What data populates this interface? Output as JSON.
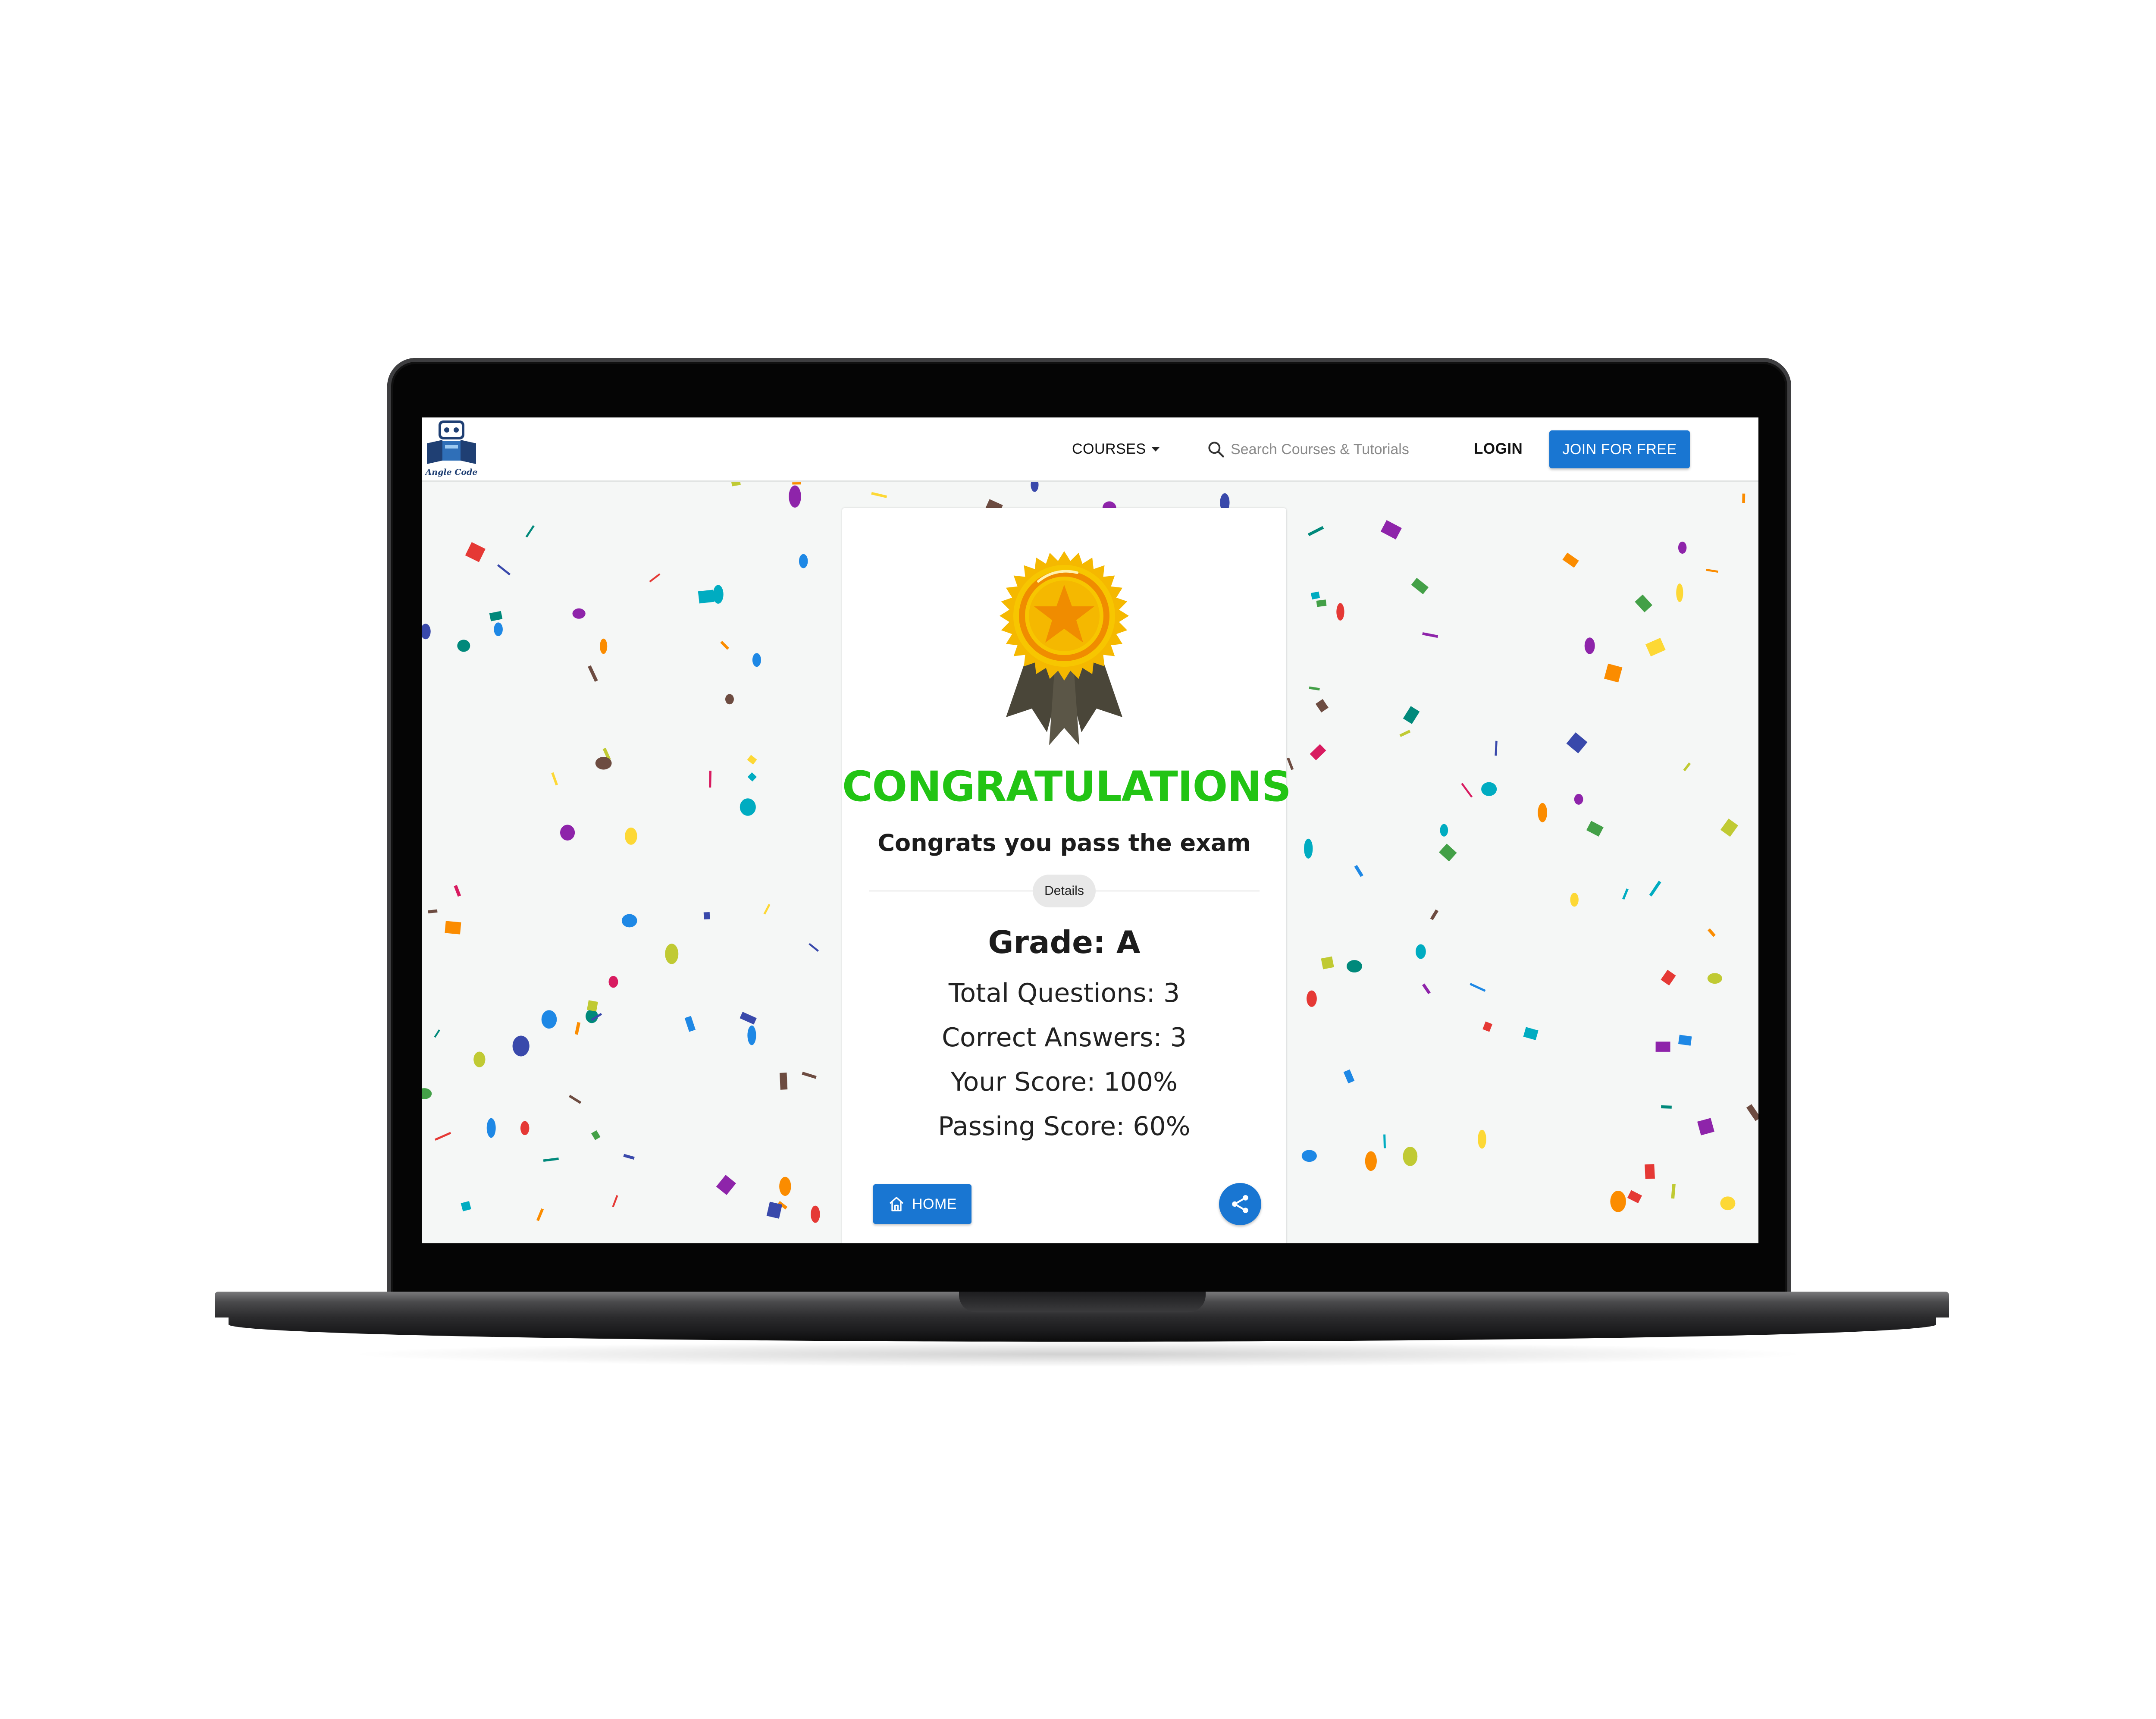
{
  "navbar": {
    "logo_text": "Angle Code",
    "courses_label": "COURSES",
    "search_placeholder": "Search Courses & Tutorials",
    "login_label": "LOGIN",
    "join_label": "JOIN FOR FREE"
  },
  "result": {
    "title": "CONGRATULATIONS",
    "subtitle": "Congrats you pass the exam",
    "details_label": "Details",
    "grade": "Grade: A",
    "total_questions": "Total Questions: 3",
    "correct_answers": "Correct Answers: 3",
    "your_score": "Your Score: 100%",
    "passing_score": "Passing Score: 60%",
    "home_label": "HOME"
  },
  "icons": [
    "robot-logo-icon",
    "chevron-down-icon",
    "search-icon",
    "medal-icon",
    "home-icon",
    "share-icon"
  ],
  "colors": {
    "primary": "#1976d2",
    "congrats_green": "#22c414",
    "medal_gold": "#f5b800",
    "ribbon": "#4a4639"
  }
}
